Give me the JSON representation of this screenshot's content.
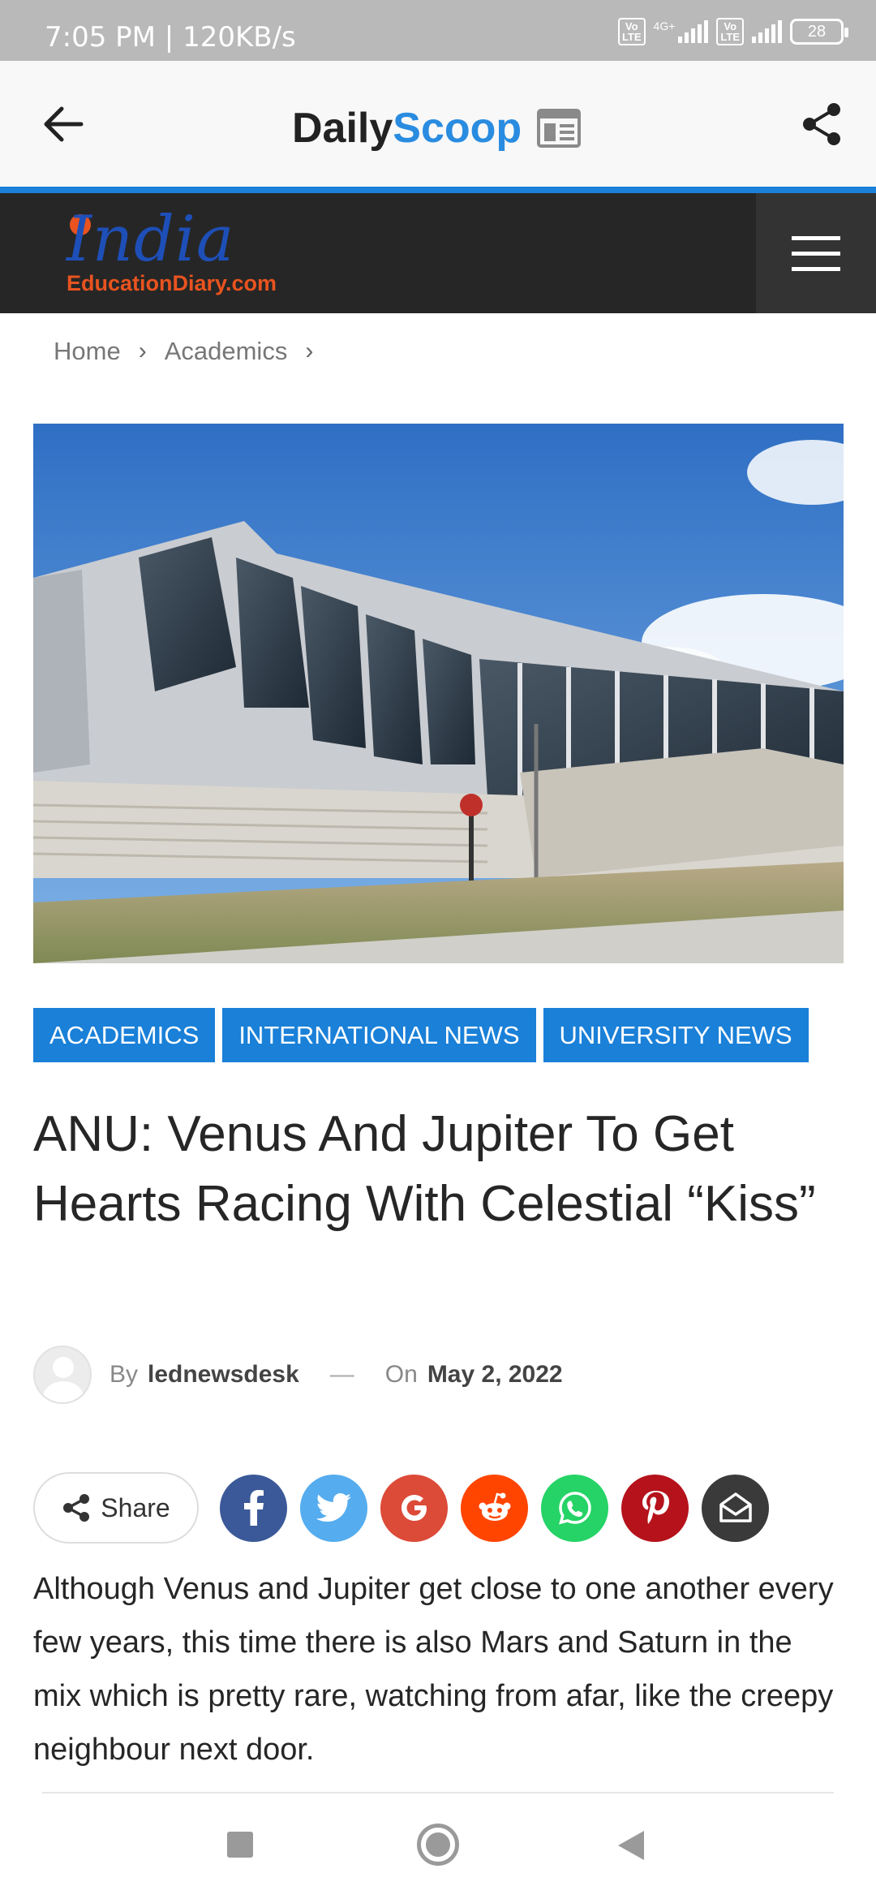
{
  "status_bar": {
    "time": "7:05 PM | 120KB/s",
    "lte1": "Vo\nLTE",
    "net": "4G+",
    "lte2": "Vo\nLTE",
    "battery": "28"
  },
  "app_bar": {
    "brand_part1": "Daily",
    "brand_part2": "Scoop"
  },
  "site": {
    "logo_word": "India",
    "logo_sub": "EducationDiary.com"
  },
  "breadcrumb": {
    "home": "Home",
    "section": "Academics"
  },
  "tags": [
    "ACADEMICS",
    "INTERNATIONAL NEWS",
    "UNIVERSITY NEWS"
  ],
  "article": {
    "title": "ANU: Venus And Jupiter To Get Hearts Racing With Celestial “Kiss”",
    "by_label": "By",
    "author": "lednewsdesk",
    "dash": "—",
    "on_label": "On",
    "date": "May 2, 2022",
    "body": "Although Venus and Jupiter get close to one another every few years, this time there is also Mars and Saturn in the mix which is pretty rare, watching from afar, like the creepy neighbour next door."
  },
  "share": {
    "label": "Share",
    "networks": [
      {
        "name": "facebook",
        "color": "#3b5998"
      },
      {
        "name": "twitter",
        "color": "#55acee"
      },
      {
        "name": "google",
        "color": "#dc4a38"
      },
      {
        "name": "reddit",
        "color": "#ff4500"
      },
      {
        "name": "whatsapp",
        "color": "#25d366"
      },
      {
        "name": "pinterest",
        "color": "#b5121b"
      },
      {
        "name": "email",
        "color": "#3a3a3a"
      }
    ]
  },
  "colors": {
    "accent": "#1a80d8",
    "header_dark": "#262626",
    "logo_orange": "#e8531f"
  }
}
